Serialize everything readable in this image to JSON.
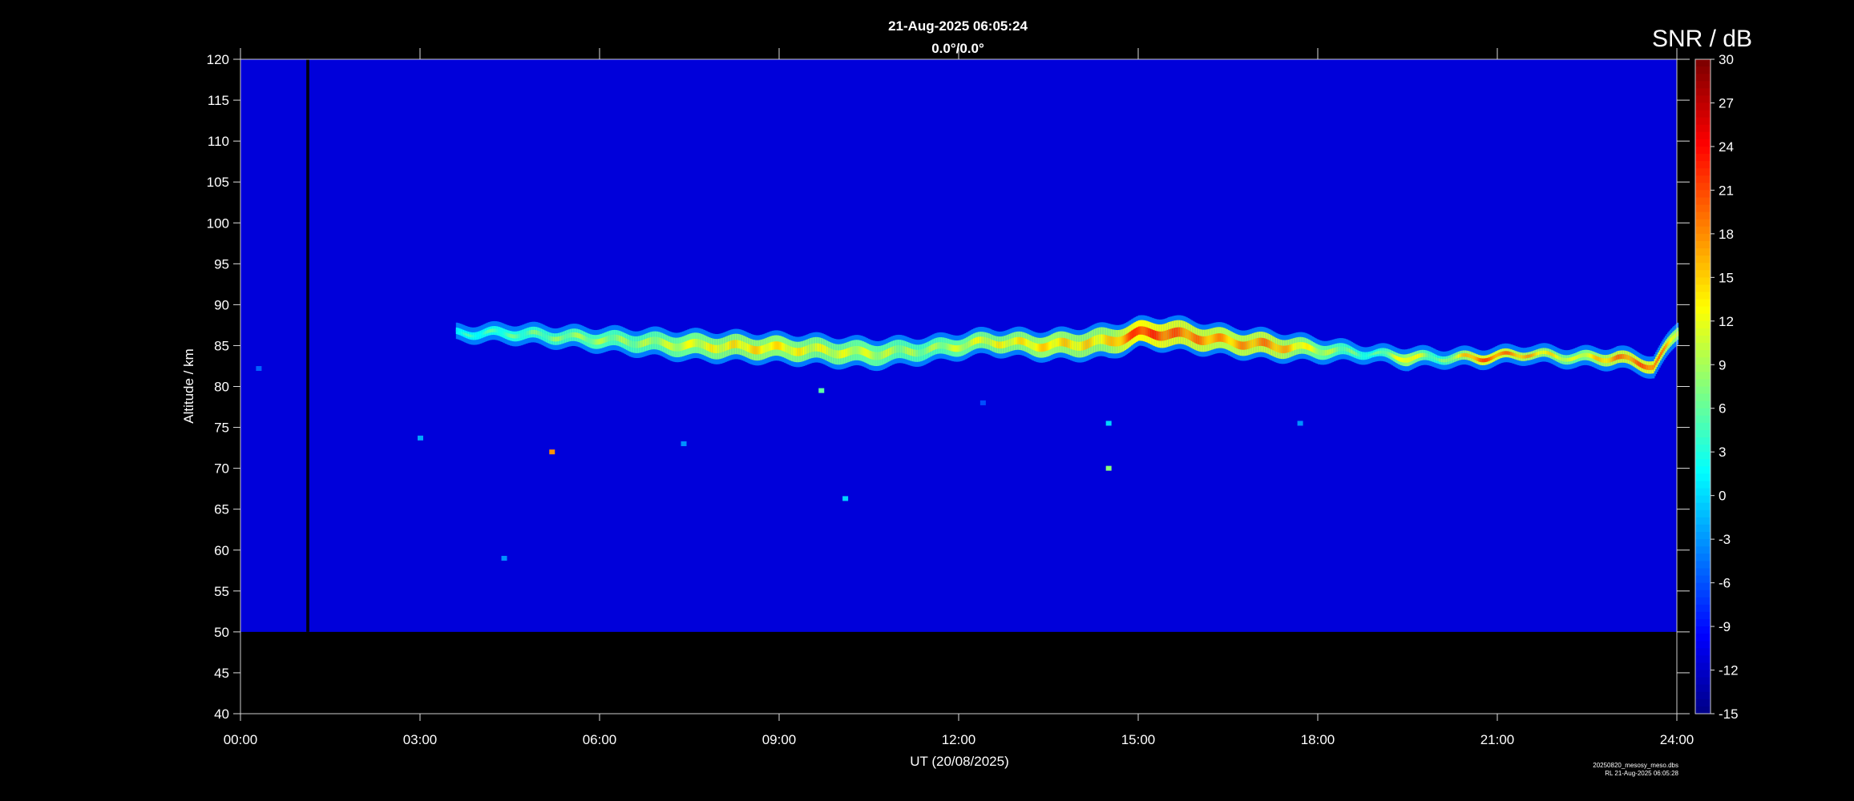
{
  "chart_data": {
    "type": "heatmap",
    "title": "21-Aug-2025 06:05:24",
    "subtitle": "0.0°/0.0°",
    "xlabel": "UT (20/08/2025)",
    "ylabel": "Altitude / km",
    "x_ticks": [
      "00:00",
      "03:00",
      "06:00",
      "09:00",
      "12:00",
      "15:00",
      "18:00",
      "21:00",
      "24:00"
    ],
    "y_ticks": [
      "40",
      "45",
      "50",
      "55",
      "60",
      "65",
      "70",
      "75",
      "80",
      "85",
      "90",
      "95",
      "100",
      "105",
      "110",
      "115",
      "120"
    ],
    "xlim_hours": [
      0,
      24
    ],
    "ylim_km": [
      40,
      120
    ],
    "data_altitude_range_km": [
      50,
      120
    ],
    "colorbar": {
      "label": "SNR / dB",
      "ticks": [
        "30",
        "27",
        "24",
        "21",
        "18",
        "15",
        "12",
        "9",
        "6",
        "3",
        "0",
        "-3",
        "-6",
        "-9",
        "-12",
        "-15"
      ],
      "range_db": [
        -15,
        30
      ],
      "colormap": "jet"
    },
    "background_snr_db": -11,
    "data_gap": {
      "start_hour": 1.1,
      "end_hour": 1.15
    },
    "echo_layer": [
      {
        "hour": 3.6,
        "alt_km": 86.5,
        "thickness_km": 0.8,
        "snr_db": 3
      },
      {
        "hour": 4.5,
        "alt_km": 86.5,
        "thickness_km": 1.2,
        "snr_db": 5
      },
      {
        "hour": 5.5,
        "alt_km": 86.0,
        "thickness_km": 1.5,
        "snr_db": 8
      },
      {
        "hour": 6.5,
        "alt_km": 85.5,
        "thickness_km": 2.0,
        "snr_db": 8
      },
      {
        "hour": 7.5,
        "alt_km": 85.0,
        "thickness_km": 2.5,
        "snr_db": 11
      },
      {
        "hour": 8.5,
        "alt_km": 84.8,
        "thickness_km": 2.5,
        "snr_db": 14
      },
      {
        "hour": 9.5,
        "alt_km": 84.5,
        "thickness_km": 2.5,
        "snr_db": 12
      },
      {
        "hour": 10.5,
        "alt_km": 84.0,
        "thickness_km": 2.5,
        "snr_db": 10
      },
      {
        "hour": 11.5,
        "alt_km": 84.5,
        "thickness_km": 2.0,
        "snr_db": 8
      },
      {
        "hour": 12.5,
        "alt_km": 85.5,
        "thickness_km": 2.0,
        "snr_db": 12
      },
      {
        "hour": 13.5,
        "alt_km": 85.0,
        "thickness_km": 2.5,
        "snr_db": 14
      },
      {
        "hour": 14.5,
        "alt_km": 85.5,
        "thickness_km": 3.0,
        "snr_db": 14
      },
      {
        "hour": 15.0,
        "alt_km": 86.5,
        "thickness_km": 2.5,
        "snr_db": 22
      },
      {
        "hour": 15.5,
        "alt_km": 86.5,
        "thickness_km": 3.0,
        "snr_db": 20
      },
      {
        "hour": 16.5,
        "alt_km": 85.5,
        "thickness_km": 2.5,
        "snr_db": 16
      },
      {
        "hour": 17.2,
        "alt_km": 85.0,
        "thickness_km": 2.5,
        "snr_db": 18
      },
      {
        "hour": 18.0,
        "alt_km": 84.5,
        "thickness_km": 1.8,
        "snr_db": 10
      },
      {
        "hour": 18.9,
        "alt_km": 84.0,
        "thickness_km": 0.8,
        "snr_db": 4
      },
      {
        "hour": 19.5,
        "alt_km": 83.5,
        "thickness_km": 1.5,
        "snr_db": 14
      },
      {
        "hour": 20.0,
        "alt_km": 83.5,
        "thickness_km": 1.0,
        "snr_db": 5
      },
      {
        "hour": 20.7,
        "alt_km": 83.5,
        "thickness_km": 1.2,
        "snr_db": 20
      },
      {
        "hour": 21.5,
        "alt_km": 84.0,
        "thickness_km": 1.0,
        "snr_db": 16
      },
      {
        "hour": 22.3,
        "alt_km": 83.5,
        "thickness_km": 1.2,
        "snr_db": 10
      },
      {
        "hour": 23.0,
        "alt_km": 83.5,
        "thickness_km": 1.5,
        "snr_db": 18
      },
      {
        "hour": 23.6,
        "alt_km": 82.5,
        "thickness_km": 1.5,
        "snr_db": 20
      },
      {
        "hour": 24.0,
        "alt_km": 86.5,
        "thickness_km": 1.5,
        "snr_db": 12
      }
    ],
    "isolated_echoes": [
      {
        "hour": 0.3,
        "alt_km": 82.2,
        "snr_db": -5
      },
      {
        "hour": 5.2,
        "alt_km": 72.0,
        "snr_db": 18
      },
      {
        "hour": 7.4,
        "alt_km": 73.0,
        "snr_db": -3
      },
      {
        "hour": 9.7,
        "alt_km": 79.5,
        "snr_db": 6
      },
      {
        "hour": 3.0,
        "alt_km": 73.7,
        "snr_db": -2
      },
      {
        "hour": 4.4,
        "alt_km": 59.0,
        "snr_db": -3
      },
      {
        "hour": 10.1,
        "alt_km": 66.3,
        "snr_db": 0
      },
      {
        "hour": 14.5,
        "alt_km": 70.0,
        "snr_db": 8
      },
      {
        "hour": 14.5,
        "alt_km": 75.5,
        "snr_db": 0
      },
      {
        "hour": 17.7,
        "alt_km": 75.5,
        "snr_db": -3
      },
      {
        "hour": 12.4,
        "alt_km": 78.0,
        "snr_db": -6
      }
    ]
  },
  "footer": {
    "filename": "20250820_mesosy_meso.dbs",
    "stamp": "RL  21-Aug-2025 06:05:28"
  },
  "colors": {
    "background": "#000000",
    "axis": "#ffffff"
  }
}
